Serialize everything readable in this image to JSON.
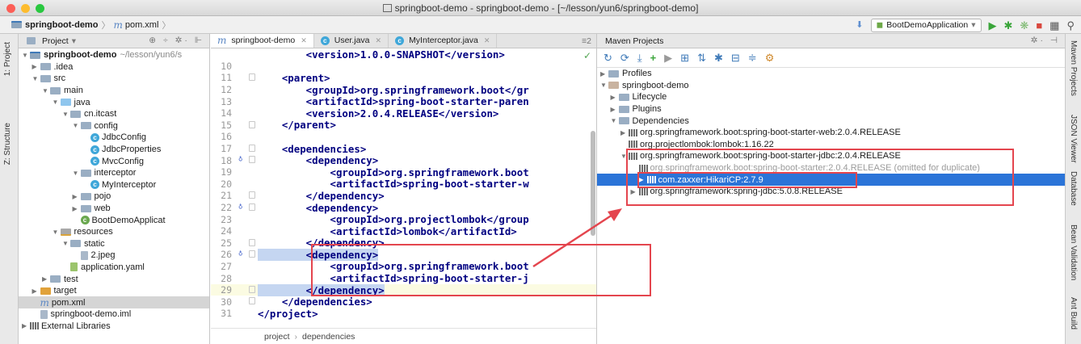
{
  "window": {
    "title": "springboot-demo - springboot-demo - [~/lesson/yun6/springboot-demo]"
  },
  "breadcrumb": {
    "project": "springboot-demo",
    "file": "pom.xml"
  },
  "run_config": {
    "name": "BootDemoApplication"
  },
  "left_tool_tabs": {
    "project": "1: Project",
    "structure": "Z: Structure"
  },
  "project_panel": {
    "header": "Project",
    "tree": [
      {
        "label": "springboot-demo",
        "extra": "~/lesson/yun6/s",
        "depth": 0,
        "arrow": "▼",
        "icon": "module-folder-icon",
        "bold": true
      },
      {
        "label": ".idea",
        "depth": 1,
        "arrow": "▶",
        "icon": "folder-icon"
      },
      {
        "label": "src",
        "depth": 1,
        "arrow": "▼",
        "icon": "folder-icon"
      },
      {
        "label": "main",
        "depth": 2,
        "arrow": "▼",
        "icon": "folder-icon"
      },
      {
        "label": "java",
        "depth": 3,
        "arrow": "▼",
        "icon": "source-folder-icon"
      },
      {
        "label": "cn.itcast",
        "depth": 4,
        "arrow": "▼",
        "icon": "package-icon"
      },
      {
        "label": "config",
        "depth": 5,
        "arrow": "▼",
        "icon": "package-icon"
      },
      {
        "label": "JdbcConfig",
        "depth": 6,
        "arrow": "",
        "icon": "class-icon"
      },
      {
        "label": "JdbcProperties",
        "depth": 6,
        "arrow": "",
        "icon": "class-icon"
      },
      {
        "label": "MvcConfig",
        "depth": 6,
        "arrow": "",
        "icon": "class-icon"
      },
      {
        "label": "interceptor",
        "depth": 5,
        "arrow": "▼",
        "icon": "package-icon"
      },
      {
        "label": "MyInterceptor",
        "depth": 6,
        "arrow": "",
        "icon": "class-icon"
      },
      {
        "label": "pojo",
        "depth": 5,
        "arrow": "▶",
        "icon": "package-icon"
      },
      {
        "label": "web",
        "depth": 5,
        "arrow": "▶",
        "icon": "package-icon"
      },
      {
        "label": "BootDemoApplicat",
        "depth": 5,
        "arrow": "",
        "icon": "spring-boot-class-icon"
      },
      {
        "label": "resources",
        "depth": 3,
        "arrow": "▼",
        "icon": "resources-folder-icon"
      },
      {
        "label": "static",
        "depth": 4,
        "arrow": "▼",
        "icon": "folder-icon"
      },
      {
        "label": "2.jpeg",
        "depth": 5,
        "arrow": "",
        "icon": "image-file-icon"
      },
      {
        "label": "application.yaml",
        "depth": 4,
        "arrow": "",
        "icon": "yaml-file-icon"
      },
      {
        "label": "test",
        "depth": 2,
        "arrow": "▶",
        "icon": "folder-icon"
      },
      {
        "label": "target",
        "depth": 1,
        "arrow": "▶",
        "icon": "excluded-folder-icon"
      },
      {
        "label": "pom.xml",
        "depth": 1,
        "arrow": "",
        "icon": "maven-file-icon",
        "selected": true
      },
      {
        "label": "springboot-demo.iml",
        "depth": 1,
        "arrow": "",
        "icon": "iml-file-icon"
      },
      {
        "label": "External Libraries",
        "depth": 0,
        "arrow": "▶",
        "icon": "library-icon"
      }
    ]
  },
  "editor": {
    "tabs": [
      {
        "label": "springboot-demo",
        "icon": "maven-file-icon",
        "active": true
      },
      {
        "label": "User.java",
        "icon": "class-icon"
      },
      {
        "label": "MyInterceptor.java",
        "icon": "class-icon"
      }
    ],
    "tab_overflow": "≡2",
    "lines": [
      {
        "n": "",
        "code": "        <version>1.0.0-SNAPSHOT</version>"
      },
      {
        "n": "10",
        "code": ""
      },
      {
        "n": "11",
        "code": "    <parent>"
      },
      {
        "n": "12",
        "code": "        <groupId>org.springframework.boot</gr"
      },
      {
        "n": "13",
        "code": "        <artifactId>spring-boot-starter-paren"
      },
      {
        "n": "14",
        "code": "        <version>2.0.4.RELEASE</version>"
      },
      {
        "n": "15",
        "code": "    </parent>"
      },
      {
        "n": "16",
        "code": ""
      },
      {
        "n": "17",
        "code": "    <dependencies>"
      },
      {
        "n": "18",
        "code": "        <dependency>"
      },
      {
        "n": "19",
        "code": "            <groupId>org.springframework.boot"
      },
      {
        "n": "20",
        "code": "            <artifactId>spring-boot-starter-w"
      },
      {
        "n": "21",
        "code": "        </dependency>"
      },
      {
        "n": "22",
        "code": "        <dependency>"
      },
      {
        "n": "23",
        "code": "            <groupId>org.projectlombok</group"
      },
      {
        "n": "24",
        "code": "            <artifactId>lombok</artifactId>"
      },
      {
        "n": "25",
        "code": "        </dependency>"
      },
      {
        "n": "26",
        "code": "        <dependency>"
      },
      {
        "n": "27",
        "code": "            <groupId>org.springframework.boot"
      },
      {
        "n": "28",
        "code": "            <artifactId>spring-boot-starter-j"
      },
      {
        "n": "29",
        "code": "        </dependency>"
      },
      {
        "n": "30",
        "code": "    </dependencies>"
      },
      {
        "n": "31",
        "code": "</project>"
      }
    ],
    "footer": {
      "path": [
        "project",
        "dependencies"
      ]
    }
  },
  "maven_panel": {
    "header": "Maven Projects",
    "tree": [
      {
        "label": "Profiles",
        "depth": 0,
        "arrow": "▶",
        "icon": "folder-icon"
      },
      {
        "label": "springboot-demo",
        "depth": 0,
        "arrow": "▼",
        "icon": "maven-project-icon"
      },
      {
        "label": "Lifecycle",
        "depth": 1,
        "arrow": "▶",
        "icon": "folder-icon"
      },
      {
        "label": "Plugins",
        "depth": 1,
        "arrow": "▶",
        "icon": "folder-icon"
      },
      {
        "label": "Dependencies",
        "depth": 1,
        "arrow": "▼",
        "icon": "folder-icon"
      },
      {
        "label": "org.springframework.boot:spring-boot-starter-web:2.0.4.RELEASE",
        "depth": 2,
        "arrow": "▶",
        "icon": "library-icon"
      },
      {
        "label": "org.projectlombok:lombok:1.16.22",
        "depth": 2,
        "arrow": "",
        "icon": "library-icon"
      },
      {
        "label": "org.springframework.boot:spring-boot-starter-jdbc:2.0.4.RELEASE",
        "depth": 2,
        "arrow": "▼",
        "icon": "library-icon"
      },
      {
        "label": "org.springframework.boot:spring-boot-starter:2.0.4.RELEASE (omitted for duplicate)",
        "depth": 3,
        "arrow": "",
        "icon": "library-icon",
        "gray": true
      },
      {
        "label": "com.zaxxer:HikariCP:2.7.9",
        "depth": 3,
        "arrow": "▶",
        "icon": "library-icon",
        "selected": true
      },
      {
        "label": "org.springframework:spring-jdbc:5.0.8.RELEASE",
        "depth": 3,
        "arrow": "▶",
        "icon": "library-icon"
      }
    ]
  },
  "right_tool_tabs": [
    "Maven Projects",
    "JSON Viewer",
    "Database",
    "Bean Validation",
    "Ant Build"
  ],
  "colors": {
    "selection": "#2b74d8",
    "annotation": "#e4454e",
    "xml_tag": "#000080"
  }
}
